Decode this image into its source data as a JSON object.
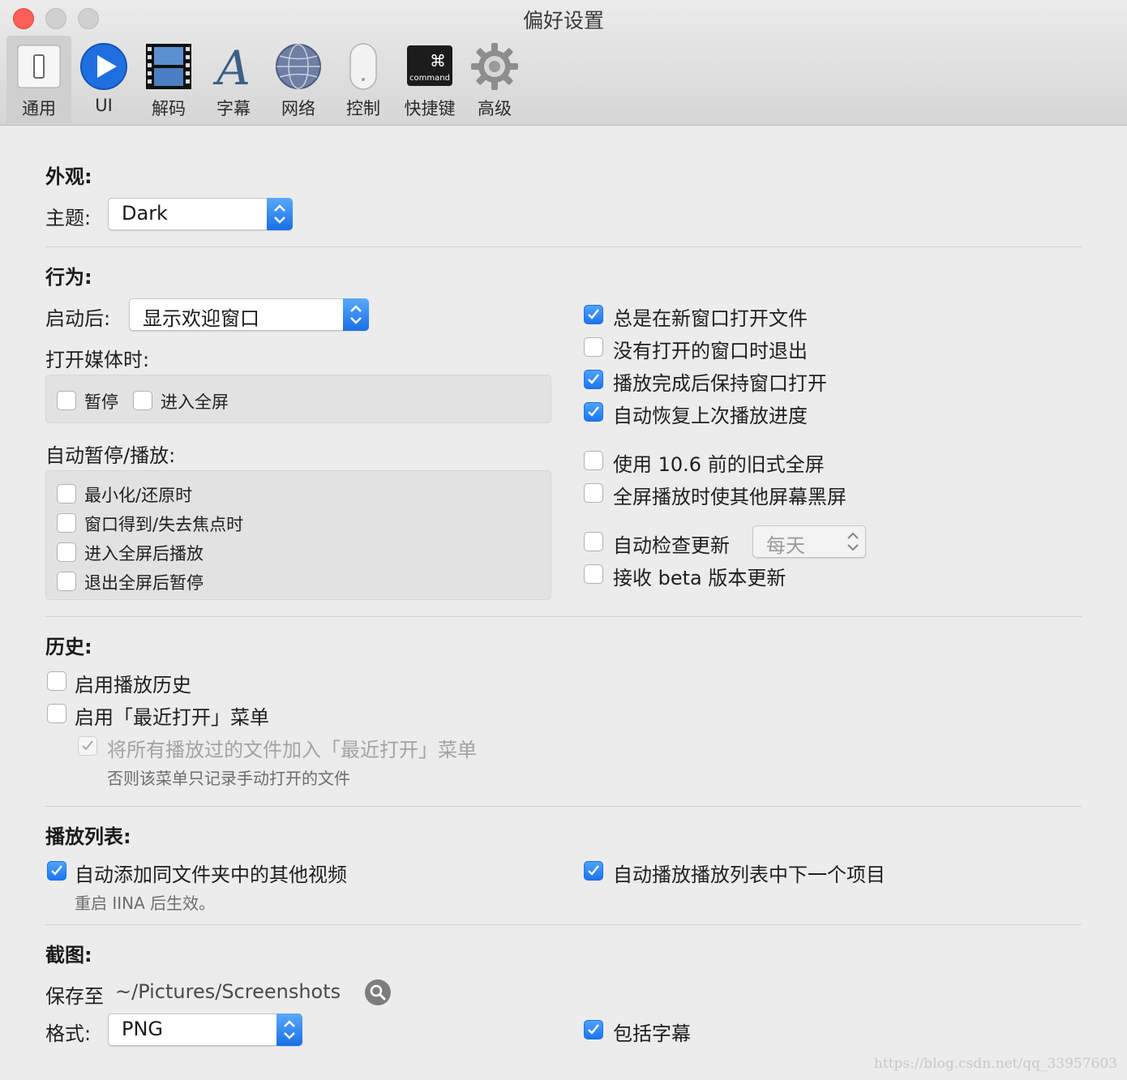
{
  "window": {
    "title": "偏好设置",
    "tabs": [
      {
        "label": "通用",
        "icon": "switch-icon"
      },
      {
        "label": "UI",
        "icon": "play-icon"
      },
      {
        "label": "解码",
        "icon": "film-icon"
      },
      {
        "label": "字幕",
        "icon": "font-a-icon"
      },
      {
        "label": "网络",
        "icon": "globe-icon"
      },
      {
        "label": "控制",
        "icon": "mouse-icon"
      },
      {
        "label": "快捷键",
        "icon": "command-key-icon"
      },
      {
        "label": "高级",
        "icon": "gear-icon"
      }
    ],
    "command_key_text": "command",
    "command_key_glyph": "⌘"
  },
  "appearance": {
    "heading": "外观:",
    "theme_label": "主题:",
    "theme_value": "Dark"
  },
  "behavior": {
    "heading": "行为:",
    "startup_label": "启动后:",
    "startup_value": "显示欢迎窗口",
    "open_media_label": "打开媒体时:",
    "open_media_options": [
      {
        "label": "暂停",
        "checked": false
      },
      {
        "label": "进入全屏",
        "checked": false
      }
    ],
    "auto_pause_label": "自动暂停/播放:",
    "auto_pause_options": [
      {
        "label": "最小化/还原时",
        "checked": false
      },
      {
        "label": "窗口得到/失去焦点时",
        "checked": false
      },
      {
        "label": "进入全屏后播放",
        "checked": false
      },
      {
        "label": "退出全屏后暂停",
        "checked": false
      }
    ],
    "right_options": [
      {
        "label": "总是在新窗口打开文件",
        "checked": true
      },
      {
        "label": "没有打开的窗口时退出",
        "checked": false
      },
      {
        "label": "播放完成后保持窗口打开",
        "checked": true
      },
      {
        "label": "自动恢复上次播放进度",
        "checked": true
      },
      {
        "label": "使用 10.6 前的旧式全屏",
        "checked": false
      },
      {
        "label": "全屏播放时使其他屏幕黑屏",
        "checked": false
      },
      {
        "label": "自动检查更新",
        "checked": false
      },
      {
        "label": "接收 beta 版本更新",
        "checked": false
      }
    ],
    "update_interval": "每天"
  },
  "history": {
    "heading": "历史:",
    "enable_history": {
      "label": "启用播放历史",
      "checked": false
    },
    "enable_recent": {
      "label": "启用「最近打开」菜单",
      "checked": false
    },
    "add_all": {
      "label": "将所有播放过的文件加入「最近打开」菜单",
      "checked": true
    },
    "add_all_note": "否则该菜单只记录手动打开的文件"
  },
  "playlist": {
    "heading": "播放列表:",
    "auto_add": {
      "label": "自动添加同文件夹中的其他视频",
      "checked": true
    },
    "auto_add_note": "重启 IINA 后生效。",
    "auto_next": {
      "label": "自动播放播放列表中下一个项目",
      "checked": true
    }
  },
  "screenshot": {
    "heading": "截图:",
    "save_label": "保存至",
    "save_path": "~/Pictures/Screenshots",
    "format_label": "格式:",
    "format_value": "PNG",
    "include_subtitles": {
      "label": "包括字幕",
      "checked": true
    }
  },
  "watermark": "https://blog.csdn.net/qq_33957603",
  "colors": {
    "accent": "#1c75f0",
    "close": "#fc5f57"
  }
}
